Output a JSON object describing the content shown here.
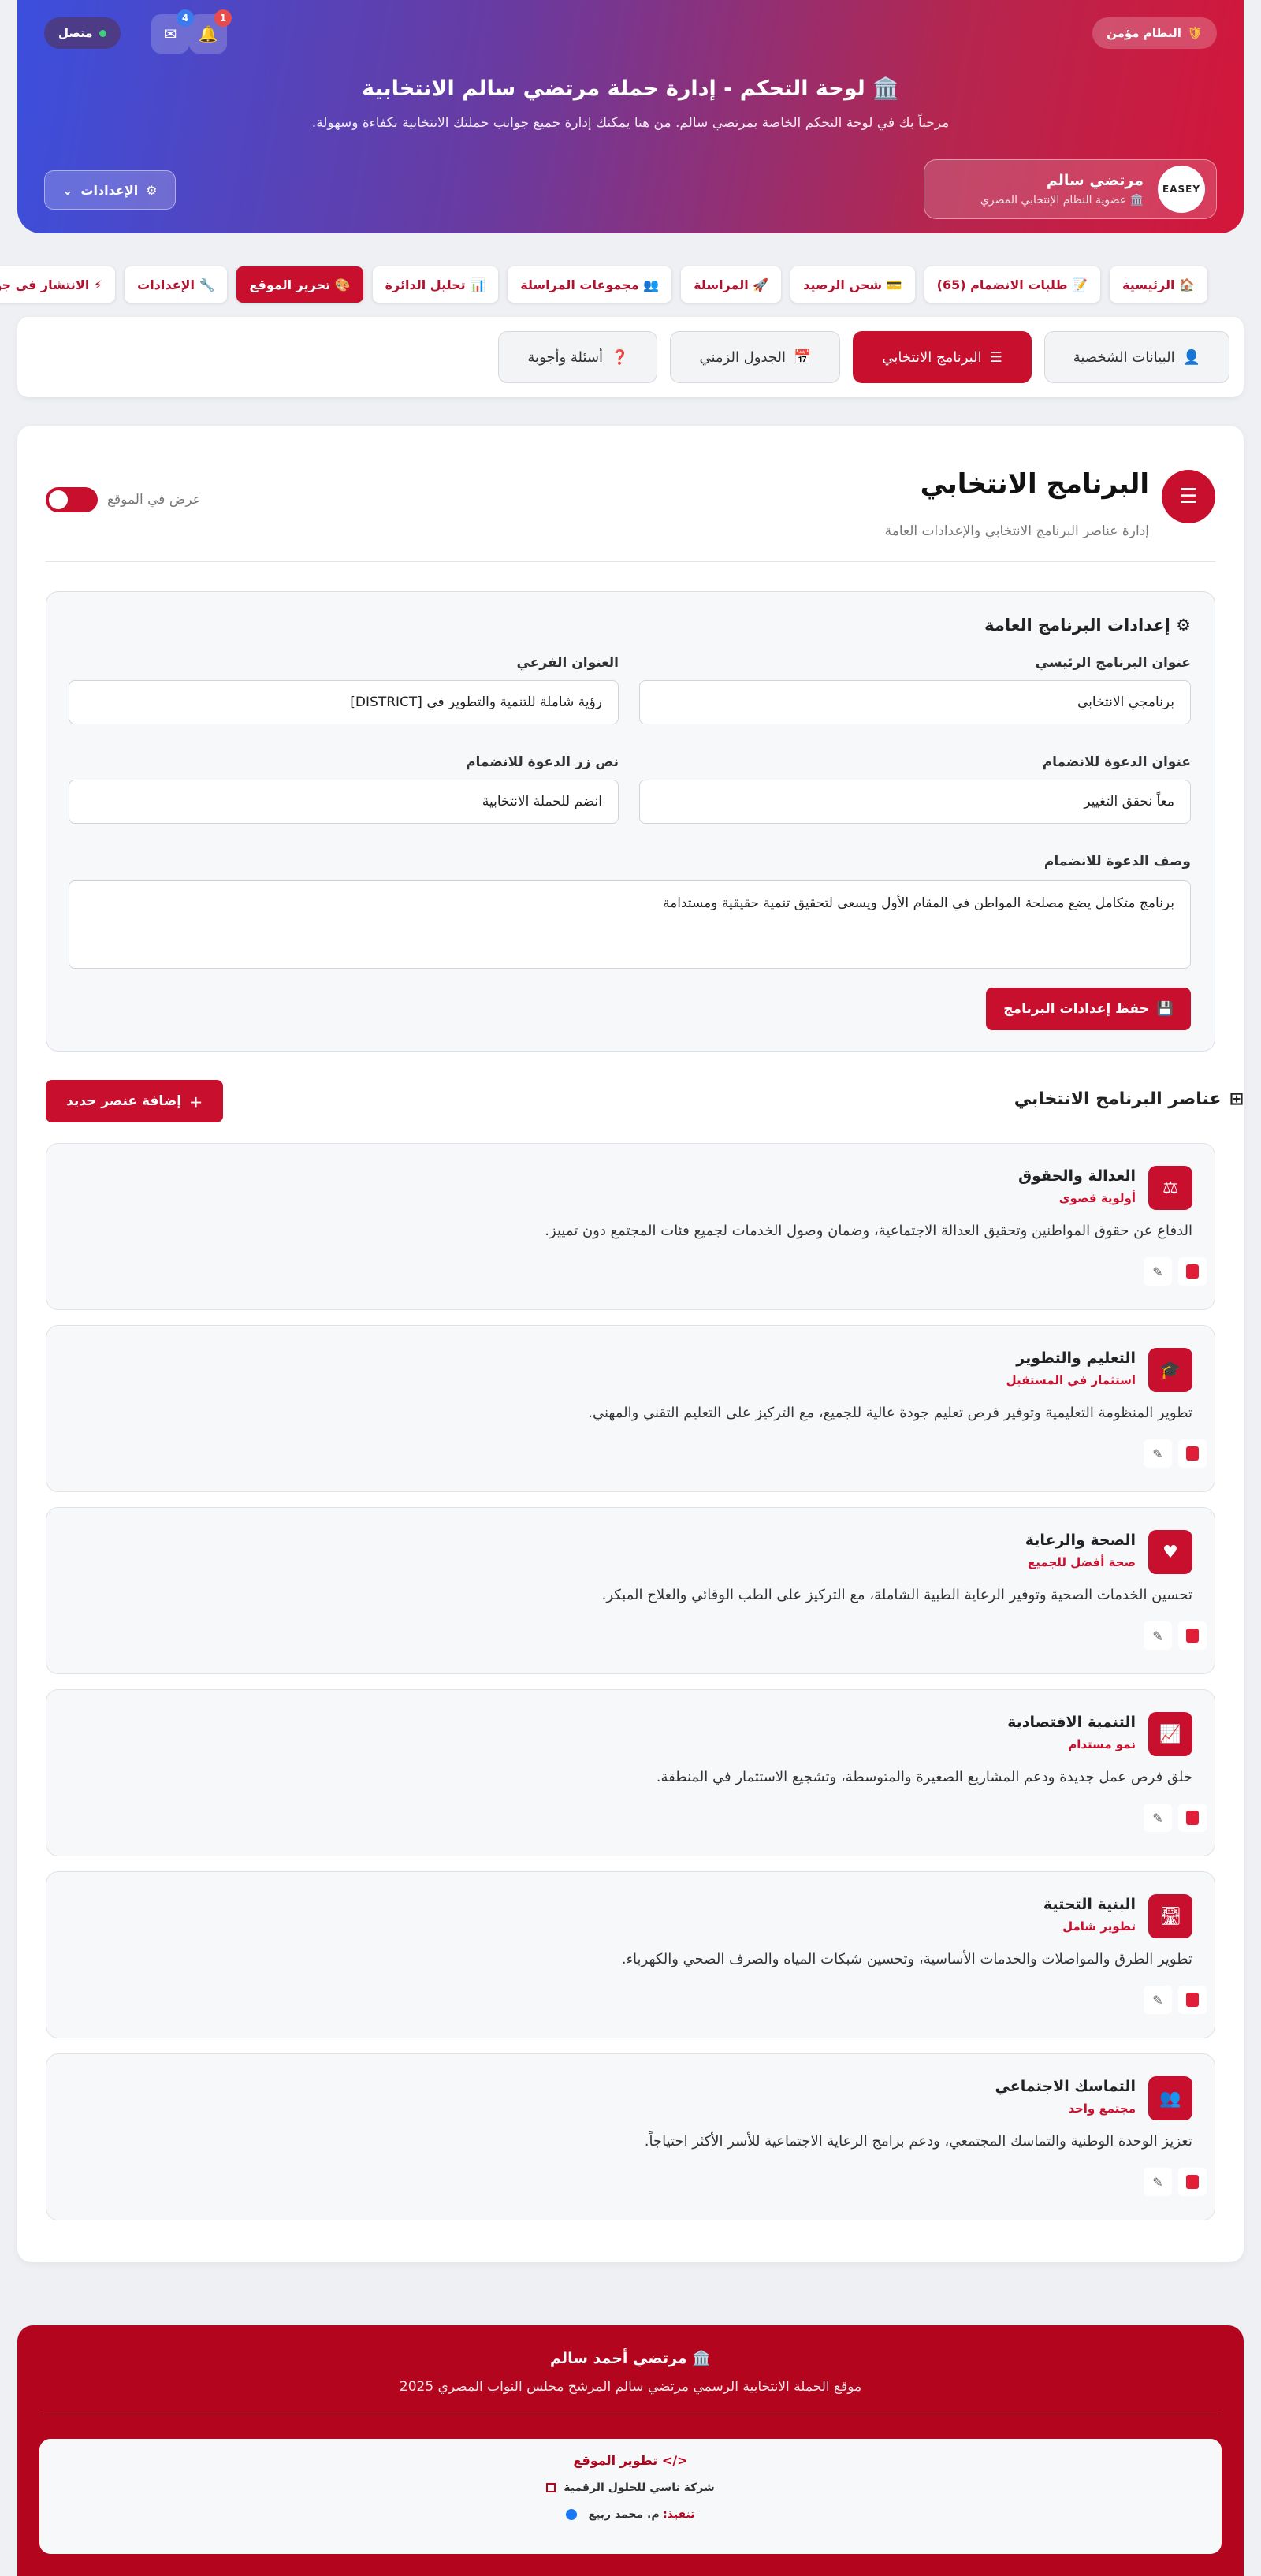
{
  "header": {
    "secure_label": "النظام مؤمن",
    "online_label": "متصل",
    "bell_count": "1",
    "mail_count": "4",
    "title": "🏛️ لوحة التحكم - إدارة حملة مرتضي سالم الانتخابية",
    "subtitle": "مرحباً بك في لوحة التحكم الخاصة بمرتضي سالم. من هنا يمكنك إدارة جميع جوانب حملتك الانتخابية بكفاءة وسهولة.",
    "profile_name": "مرتضي سالم",
    "profile_info": "🏛️ عضوية النظام الإنتخابي المصري",
    "avatar_text": "EASEY",
    "settings_label": "الإعدادات"
  },
  "nav": {
    "items": [
      {
        "label": "🏠 الرئيسية"
      },
      {
        "label": "📝 طلبات الانضمام (65)"
      },
      {
        "label": "💳 شحن الرصيد"
      },
      {
        "label": "🚀 المراسلة"
      },
      {
        "label": "👥 مجموعات المراسلة"
      },
      {
        "label": "📊 تحليل الدائرة"
      },
      {
        "label": "🎨 تحرير الموقع"
      },
      {
        "label": "🔧 الإعدادات"
      },
      {
        "label": "⚡ الانتشار في جوجل"
      }
    ]
  },
  "subnav": {
    "tabs": [
      {
        "label": "البيانات الشخصية"
      },
      {
        "label": "البرنامج الانتخابي"
      },
      {
        "label": "الجدول الزمني"
      },
      {
        "label": "أسئلة وأجوبة"
      }
    ]
  },
  "section": {
    "title": "البرنامج الانتخابي",
    "subtitle": "إدارة عناصر البرنامج الانتخابي والإعدادات العامة",
    "toggle_label": "عرض في الموقع"
  },
  "settings": {
    "title": "إعدادات البرنامج العامة",
    "main_title_label": "عنوان البرنامج الرئيسي",
    "main_title_value": "برنامجي الانتخابي",
    "subtitle_label": "العنوان الفرعي",
    "subtitle_value": "رؤية شاملة للتنمية والتطوير في [DISTRICT]",
    "cta_title_label": "عنوان الدعوة للانضمام",
    "cta_title_value": "معاً نحقق التغيير",
    "cta_button_label": "نص زر الدعوة للانضمام",
    "cta_button_value": "انضم للحملة الانتخابية",
    "cta_desc_label": "وصف الدعوة للانضمام",
    "cta_desc_value": "برنامج متكامل يضع مصلحة المواطن في المقام الأول ويسعى لتحقيق تنمية حقيقية ومستدامة",
    "save_label": "حفظ إعدادات البرنامج"
  },
  "items": {
    "title": "عناصر البرنامج الانتخابي",
    "add_label": "إضافة عنصر جديد",
    "list": [
      {
        "title": "العدالة والحقوق",
        "tag": "أولوية قصوى",
        "desc": "الدفاع عن حقوق المواطنين وتحقيق العدالة الاجتماعية، وضمان وصول الخدمات لجميع فئات المجتمع دون تمييز.",
        "icon": "⚖"
      },
      {
        "title": "التعليم والتطوير",
        "tag": "استثمار في المستقبل",
        "desc": "تطوير المنظومة التعليمية وتوفير فرص تعليم جودة عالية للجميع، مع التركيز على التعليم التقني والمهني.",
        "icon": "🎓"
      },
      {
        "title": "الصحة والرعاية",
        "tag": "صحة أفضل للجميع",
        "desc": "تحسين الخدمات الصحية وتوفير الرعاية الطبية الشاملة، مع التركيز على الطب الوقائي والعلاج المبكر.",
        "icon": "♥"
      },
      {
        "title": "التنمية الاقتصادية",
        "tag": "نمو مستدام",
        "desc": "خلق فرص عمل جديدة ودعم المشاريع الصغيرة والمتوسطة، وتشجيع الاستثمار في المنطقة.",
        "icon": "📈"
      },
      {
        "title": "البنية التحتية",
        "tag": "تطوير شامل",
        "desc": "تطوير الطرق والمواصلات والخدمات الأساسية، وتحسين شبكات المياه والصرف الصحي والكهرباء.",
        "icon": "🛣"
      },
      {
        "title": "التماسك الاجتماعي",
        "tag": "مجتمع واحد",
        "desc": "تعزيز الوحدة الوطنية والتماسك المجتمعي، ودعم برامج الرعاية الاجتماعية للأسر الأكثر احتياجاً.",
        "icon": "👥"
      }
    ]
  },
  "footer": {
    "title": "🏛️ مرتضي أحمد سالم",
    "subtitle": "موقع الحملة الانتخابية الرسمي مرتضي سالم المرشح مجلس النواب المصري 2025",
    "dev_title": "</> تطوير الموقع",
    "dev_company": "شركة ناسي للحلول الرقمية",
    "dev_by_label": "تنفيذ:",
    "dev_by_name": "م. محمد ربيع"
  },
  "colors": {
    "accent": "#c8102e",
    "footer": "#b3061e",
    "gradient_start": "#3b4fdd",
    "gradient_end": "#d4163a"
  }
}
